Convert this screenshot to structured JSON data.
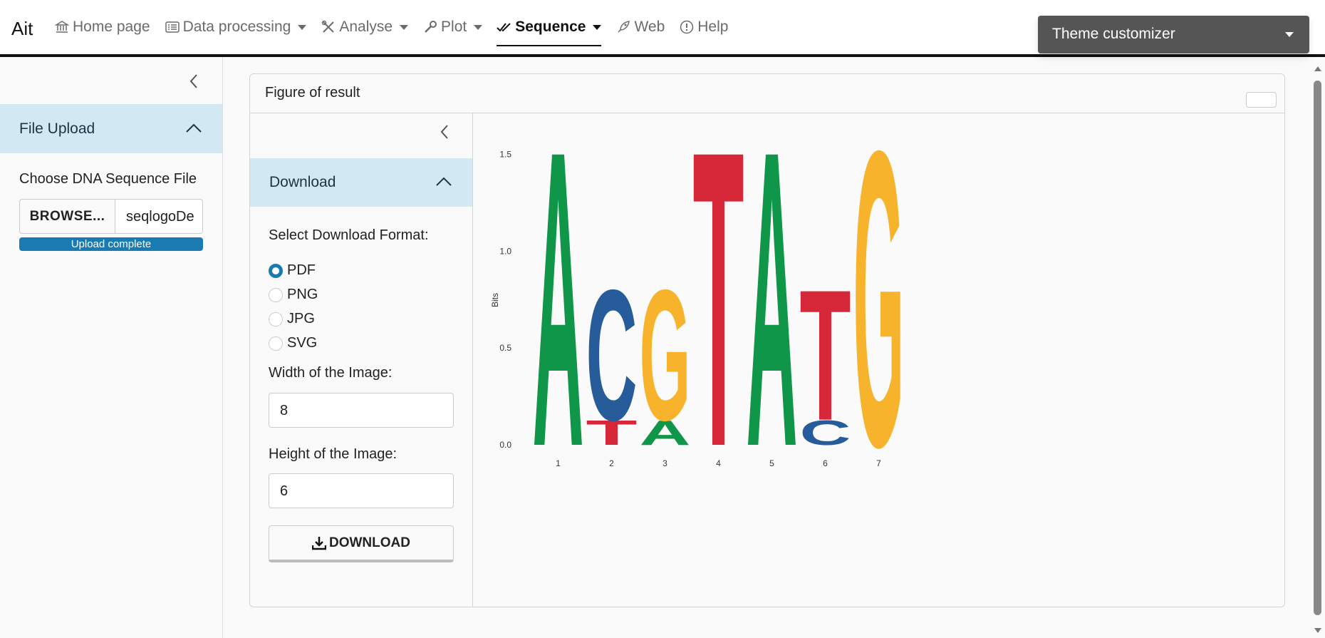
{
  "navbar": {
    "brand": "Ait",
    "items": [
      {
        "label": "Home page",
        "icon": "bank-icon",
        "dropdown": false,
        "active": false
      },
      {
        "label": "Data processing",
        "icon": "list-card-icon",
        "dropdown": true,
        "active": false
      },
      {
        "label": "Analyse",
        "icon": "tools-icon",
        "dropdown": true,
        "active": false
      },
      {
        "label": "Plot",
        "icon": "wrench-icon",
        "dropdown": true,
        "active": false
      },
      {
        "label": "Sequence",
        "icon": "double-check-icon",
        "dropdown": true,
        "active": true
      },
      {
        "label": "Web",
        "icon": "rocket-icon",
        "dropdown": false,
        "active": false
      },
      {
        "label": "Help",
        "icon": "exclamation-circle-icon",
        "dropdown": false,
        "active": false
      }
    ],
    "theme_customizer": "Theme customizer"
  },
  "sidebar": {
    "accordion_title": "File Upload",
    "file_label": "Choose DNA Sequence File",
    "browse_label": "BROWSE...",
    "file_name": "seqlogoDe",
    "progress_text": "Upload complete",
    "progress_value": 1.0
  },
  "card": {
    "title": "Figure of result",
    "download": {
      "accordion_title": "Download",
      "format_label": "Select Download Format:",
      "formats": [
        "PDF",
        "PNG",
        "JPG",
        "SVG"
      ],
      "selected_format": "PDF",
      "width_label": "Width of the Image:",
      "width_value": "8",
      "height_label": "Height of the Image:",
      "height_value": "6",
      "button_label": "DOWNLOAD"
    }
  },
  "colors": {
    "A": "#109648",
    "C": "#255c99",
    "G": "#f7b32b",
    "T": "#d62839",
    "accent": "#1a7bb3",
    "accordion_bg": "#d2e9f3"
  },
  "chart_data": {
    "type": "sequence-logo",
    "ylabel": "Bits",
    "xlabel": "",
    "ylim": [
      0,
      1.6
    ],
    "yticks": [
      "0.0",
      "0.5",
      "1.0",
      "1.5"
    ],
    "positions": [
      {
        "position": "1",
        "stack": [
          {
            "letter": "A",
            "bits": 1.56
          }
        ]
      },
      {
        "position": "2",
        "stack": [
          {
            "letter": "T",
            "bits": 0.13
          },
          {
            "letter": "C",
            "bits": 0.69
          }
        ]
      },
      {
        "position": "3",
        "stack": [
          {
            "letter": "A",
            "bits": 0.13
          },
          {
            "letter": "G",
            "bits": 0.69
          }
        ]
      },
      {
        "position": "4",
        "stack": [
          {
            "letter": "T",
            "bits": 1.56
          }
        ]
      },
      {
        "position": "5",
        "stack": [
          {
            "letter": "A",
            "bits": 1.56
          }
        ]
      },
      {
        "position": "6",
        "stack": [
          {
            "letter": "C",
            "bits": 0.13
          },
          {
            "letter": "T",
            "bits": 0.69
          }
        ]
      },
      {
        "position": "7",
        "stack": [
          {
            "letter": "G",
            "bits": 1.56
          }
        ]
      }
    ]
  }
}
